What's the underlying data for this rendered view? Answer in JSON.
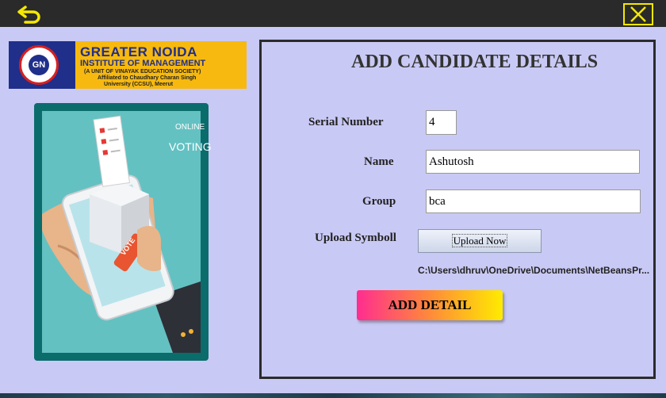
{
  "window": {
    "back_icon": "undo-arrow-icon",
    "close_icon": "close-x-icon",
    "accent_color": "#f5e800"
  },
  "logo": {
    "initials": "GN",
    "title": "GREATER NOIDA",
    "subtitle": "INSTITUTE OF MANAGEMENT",
    "line3": "(A UNIT OF VINAYAK EDUCATION SOCIETY)",
    "line4": "Affiliated to Chaudhary Charan Singh",
    "line5": "University (CCSU), Meerut"
  },
  "illustration": {
    "online": "ONLINE",
    "voting": "VOTING",
    "vote_button": "VOTE"
  },
  "form": {
    "title": "ADD CANDIDATE DETAILS",
    "serial_label": "Serial Number",
    "serial_value": "4",
    "name_label": "Name",
    "name_value": "Ashutosh",
    "group_label": "Group",
    "group_value": "bca",
    "upload_label": "Upload Symboll",
    "upload_button": "Upload Now",
    "file_path": "C:\\Users\\dhruv\\OneDrive\\Documents\\NetBeansPr...",
    "submit_button": "ADD DETAIL"
  }
}
